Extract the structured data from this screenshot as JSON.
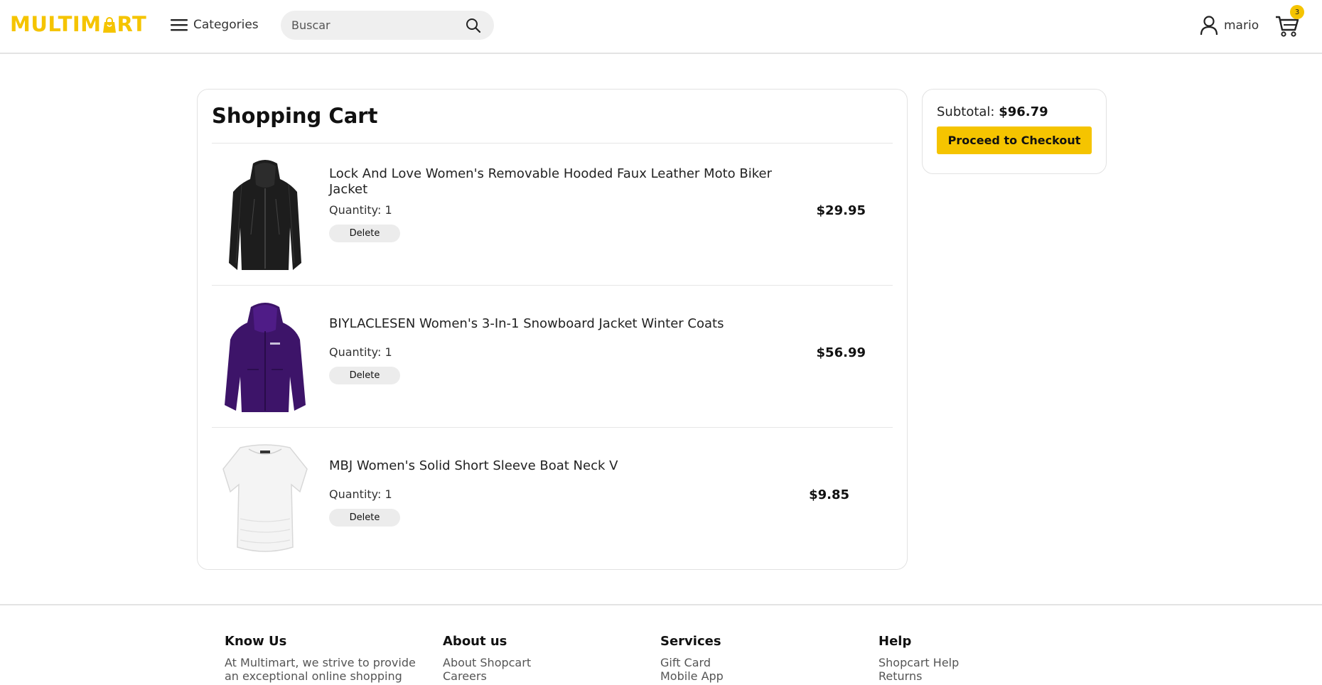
{
  "header": {
    "logo_text_a": "MULTIM",
    "logo_text_b": "RT",
    "categories_label": "Categories",
    "search_placeholder": "Buscar",
    "user_name": "mario",
    "cart_count": "3",
    "accent_color": "#f5c400"
  },
  "cart": {
    "title": "Shopping Cart",
    "items": [
      {
        "title": "Lock And Love Women's Removable Hooded Faux Leather Moto Biker Jacket",
        "quantity_label": "Quantity: 1",
        "delete_label": "Delete",
        "price": "$29.95",
        "image": "black-leather-jacket"
      },
      {
        "title": "BIYLACLESEN Women's 3-In-1 Snowboard Jacket Winter Coats",
        "quantity_label": "Quantity: 1",
        "delete_label": "Delete",
        "price": "$56.99",
        "image": "purple-snowboard-jacket"
      },
      {
        "title": "MBJ Women's Solid Short Sleeve Boat Neck V",
        "quantity_label": "Quantity: 1",
        "delete_label": "Delete",
        "price": "$9.85",
        "image": "white-boat-neck-top"
      }
    ]
  },
  "summary": {
    "subtotal_label": "Subtotal:",
    "subtotal_value": "$96.79",
    "checkout_label": "Proceed to Checkout"
  },
  "footer": {
    "columns": [
      {
        "heading": "Know Us",
        "text_line1": "At Multimart, we strive to provide",
        "text_line2": "an exceptional online shopping"
      },
      {
        "heading": "About us",
        "links": [
          "About Shopcart",
          "Careers"
        ]
      },
      {
        "heading": "Services",
        "links": [
          "Gift Card",
          "Mobile App"
        ]
      },
      {
        "heading": "Help",
        "links": [
          "Shopcart Help",
          "Returns"
        ]
      }
    ]
  }
}
